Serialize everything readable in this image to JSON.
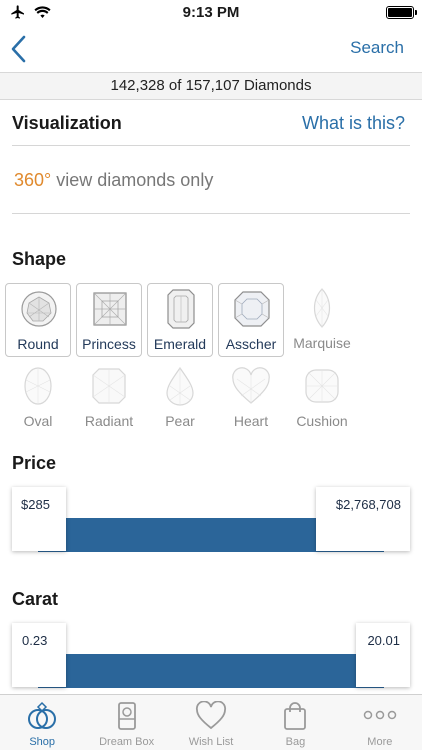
{
  "status": {
    "time": "9:13 PM"
  },
  "nav": {
    "search_label": "Search"
  },
  "count_text": "142,328 of 157,107 Diamonds",
  "visualization": {
    "title": "Visualization",
    "help_link": "What is this?",
    "view360_accent": "360°",
    "view360_text": " view diamonds only"
  },
  "shape_section": {
    "title": "Shape",
    "shapes": [
      {
        "label": "Round",
        "icon": "round-diamond-icon",
        "selected": true
      },
      {
        "label": "Princess",
        "icon": "princess-diamond-icon",
        "selected": true
      },
      {
        "label": "Emerald",
        "icon": "emerald-diamond-icon",
        "selected": true
      },
      {
        "label": "Asscher",
        "icon": "asscher-diamond-icon",
        "selected": true
      },
      {
        "label": "Marquise",
        "icon": "marquise-diamond-icon",
        "selected": false
      },
      {
        "label": "Oval",
        "icon": "oval-diamond-icon",
        "selected": false
      },
      {
        "label": "Radiant",
        "icon": "radiant-diamond-icon",
        "selected": false
      },
      {
        "label": "Pear",
        "icon": "pear-diamond-icon",
        "selected": false
      },
      {
        "label": "Heart",
        "icon": "heart-diamond-icon",
        "selected": false
      },
      {
        "label": "Cushion",
        "icon": "cushion-diamond-icon",
        "selected": false
      }
    ]
  },
  "price": {
    "title": "Price",
    "min_label": "$285",
    "max_label": "$2,768,708"
  },
  "carat": {
    "title": "Carat",
    "min_label": "0.23",
    "max_label": "20.01"
  },
  "tabs": [
    {
      "label": "Shop",
      "icon": "rings-icon",
      "active": true
    },
    {
      "label": "Dream Box",
      "icon": "ring-box-icon",
      "active": false
    },
    {
      "label": "Wish List",
      "icon": "heart-icon",
      "active": false
    },
    {
      "label": "Bag",
      "icon": "shopping-bag-icon",
      "active": false
    },
    {
      "label": "More",
      "icon": "more-dots-icon",
      "active": false
    }
  ],
  "colors": {
    "accent": "#2a6fa8",
    "orange": "#e08a2e",
    "slider": "#2b6599"
  }
}
